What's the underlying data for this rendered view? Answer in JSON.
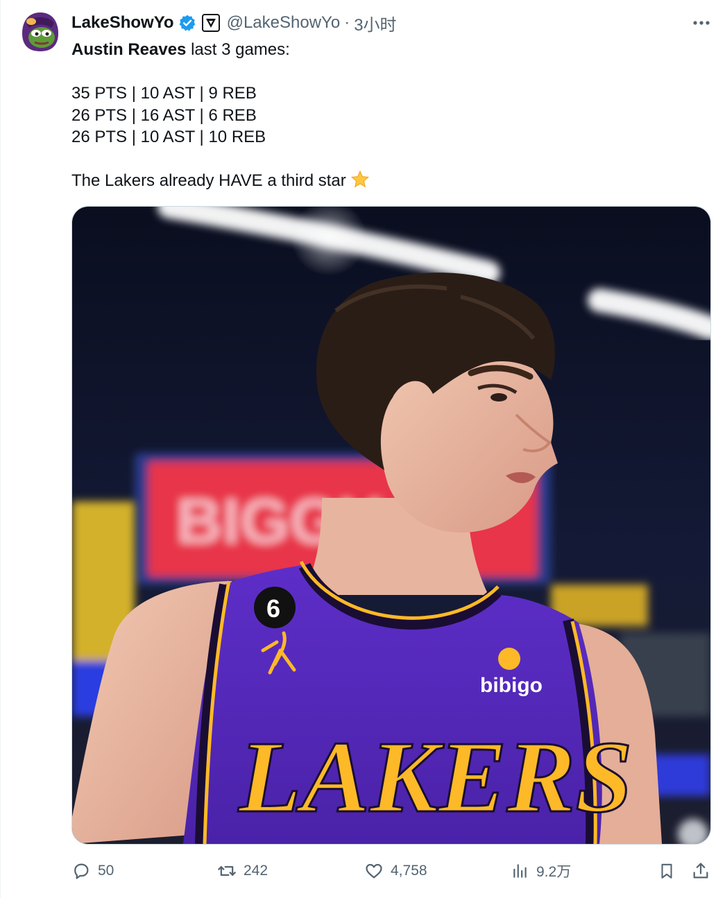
{
  "author": {
    "display_name": "LakeShowYo",
    "handle": "@LakeShowYo",
    "separator": "·",
    "time": "3小时",
    "verified_icon": "verified-badge-icon",
    "affiliate_icon": "affiliate-logo-icon"
  },
  "tweet": {
    "mention": "Austin Reaves",
    "line1_rest": " last 3 games:",
    "stats": [
      "35 PTS | 10 AST | 9 REB",
      "26 PTS | 16 AST | 6 REB",
      "26 PTS | 10 AST | 10 REB"
    ],
    "closing": "The Lakers already HAVE a third star",
    "emoji": "star-emoji"
  },
  "media": {
    "jersey_number": "6",
    "sponsor": "bibigo",
    "wordmark": "LAKERS",
    "arena_sign": "BIGGY"
  },
  "actions": {
    "replies": "50",
    "retweets": "242",
    "likes": "4,758",
    "views": "9.2万"
  },
  "colors": {
    "accent": "#1d9bf0",
    "text": "#0f1419",
    "secondary": "#536471",
    "lakers_purple": "#552583",
    "lakers_gold": "#fdb927"
  }
}
